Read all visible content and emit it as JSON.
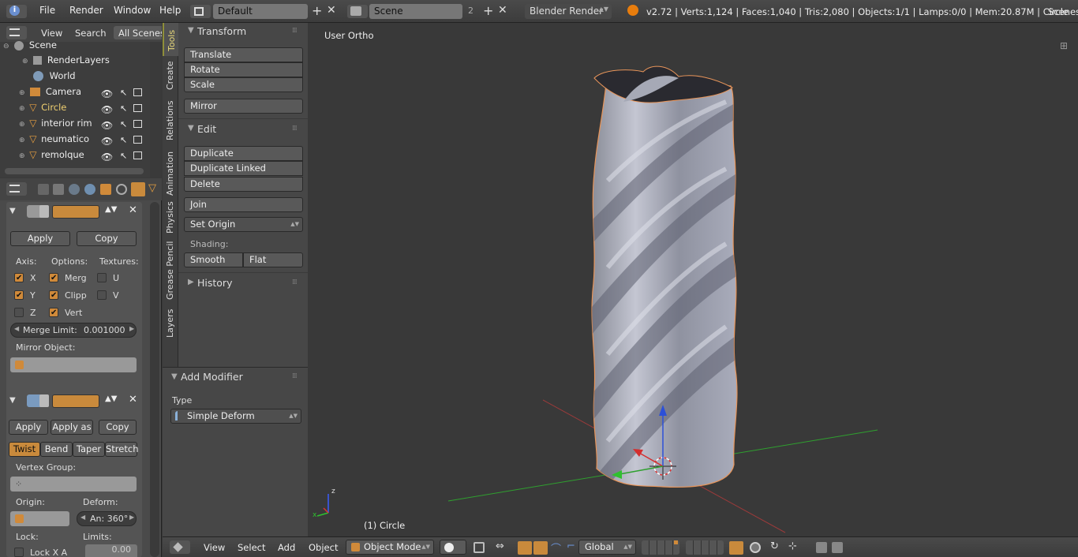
{
  "topbar": {
    "menus": [
      "File",
      "Render",
      "Window",
      "Help"
    ],
    "layout": "Default",
    "scene": "Scene",
    "scene_users": "2",
    "engine": "Blender Render",
    "stats": "v2.72 | Verts:1,124 | Faces:1,040 | Tris:2,080 | Objects:1/1 | Lamps:0/0 | Mem:20.87M | Circle",
    "scenes_label": "Scenes"
  },
  "outliner": {
    "tabs": [
      "View",
      "Search",
      "All Scenes"
    ],
    "items": [
      "Scene",
      "RenderLayers",
      "World",
      "Camera",
      "Circle",
      "interior rim",
      "neumatico",
      "remolque"
    ]
  },
  "modifiers": {
    "mirror": {
      "apply": "Apply",
      "copy": "Copy",
      "axis_label": "Axis:",
      "options_label": "Options:",
      "textures_label": "Textures:",
      "axes": [
        "X",
        "Y",
        "Z"
      ],
      "options": [
        "Merg",
        "Clipp",
        "Vert"
      ],
      "textures": [
        "U",
        "V"
      ],
      "merge_limit_label": "Merge Limit:",
      "merge_limit_value": "0.001000",
      "mirror_object_label": "Mirror Object:"
    },
    "deform": {
      "apply": "Apply",
      "apply_as": "Apply as",
      "copy": "Copy",
      "modes": [
        "Twist",
        "Bend",
        "Taper",
        "Stretch"
      ],
      "vertex_group_label": "Vertex Group:",
      "origin_label": "Origin:",
      "deform_label": "Deform:",
      "angle": "An: 360°",
      "lock_label": "Lock:",
      "limits_label": "Limits:",
      "lock_x": "Lock X A",
      "limit_value": "0.00"
    }
  },
  "tool_tabs": [
    "Tools",
    "Create",
    "Relations",
    "Animation",
    "Physics",
    "Grease Pencil",
    "Layers"
  ],
  "toolshelf": {
    "transform_title": "Transform",
    "transform_buttons": [
      "Translate",
      "Rotate",
      "Scale"
    ],
    "mirror": "Mirror",
    "edit_title": "Edit",
    "edit_buttons": [
      "Duplicate",
      "Duplicate Linked",
      "Delete"
    ],
    "join": "Join",
    "set_origin": "Set Origin",
    "shading_label": "Shading:",
    "smooth": "Smooth",
    "flat": "Flat",
    "history_title": "History",
    "add_modifier_title": "Add Modifier",
    "type_label": "Type",
    "type_value": "Simple Deform"
  },
  "viewport": {
    "view_name": "User Ortho",
    "object_label": "(1) Circle",
    "axis_x": "x",
    "axis_z": "z"
  },
  "bottombar": {
    "menus": [
      "View",
      "Select",
      "Add",
      "Object"
    ],
    "mode": "Object Mode",
    "orientation": "Global"
  }
}
